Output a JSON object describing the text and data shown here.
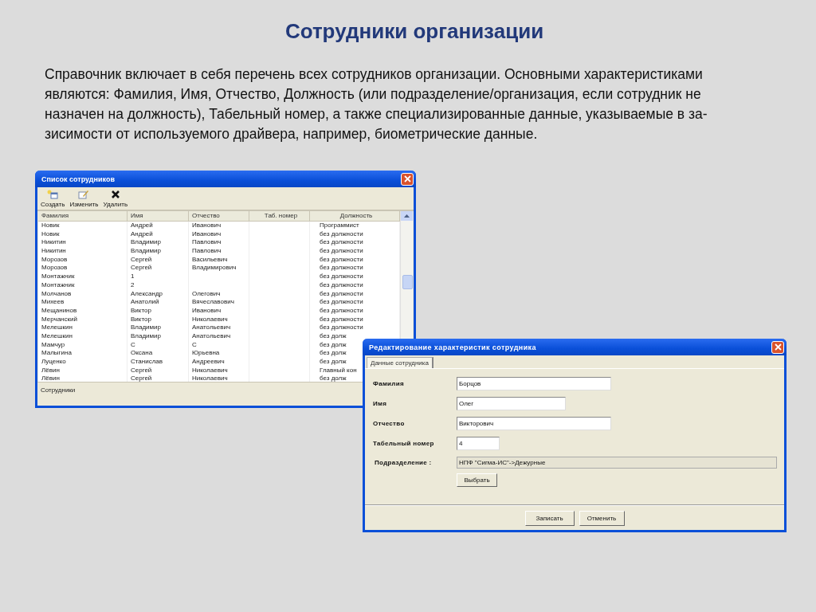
{
  "slide": {
    "title": "Сотрудники организации",
    "paragraph_lines": [
      "Справочник включает в себя перечень всех сотрудников организации. Основными характеристиками",
      "являются: Фамилия, Имя, Отчество, Должность (или подразделение/организация, если сотрудник не",
      "назначен на должность), Табельный номер, а также специализированные данные, указываемые в за-",
      "зисимости от используемого драйвера, например, биометрические данные."
    ]
  },
  "list_window": {
    "title": "Список сотрудников",
    "toolbar": [
      {
        "kind": "create",
        "label": "Создать"
      },
      {
        "kind": "edit",
        "label": "Изменить"
      },
      {
        "kind": "delete",
        "label": "Удалить"
      }
    ],
    "columns": [
      "Фамилия",
      "Имя",
      "Отчество",
      "Таб. номер",
      "Должность"
    ],
    "rows": [
      [
        "Новик",
        "Андрей",
        "Иванович",
        "",
        "Программист"
      ],
      [
        "Новик",
        "Андрей",
        "Иванович",
        "",
        "без должности"
      ],
      [
        "Никитин",
        "Владимир",
        "Павлович",
        "",
        "без должности"
      ],
      [
        "Никитин",
        "Владимир",
        "Павлович",
        "",
        "без должности"
      ],
      [
        "Морозов",
        "Сергей",
        "Васильевич",
        "",
        "без должности"
      ],
      [
        "Морозов",
        "Сергей",
        "Владимирович",
        "",
        "без должности"
      ],
      [
        "Монтажник",
        "1",
        "",
        "",
        "без должности"
      ],
      [
        "Монтажник",
        "2",
        "",
        "",
        "без должности"
      ],
      [
        "Молчанов",
        "Александр",
        "Олегович",
        "",
        "без должности"
      ],
      [
        "Михеев",
        "Анатолий",
        "Вячеславович",
        "",
        "без должности"
      ],
      [
        "Мещанинов",
        "Виктор",
        "Иванович",
        "",
        "без должности"
      ],
      [
        "Мерчанский",
        "Виктор",
        "Николаевич",
        "",
        "без должности"
      ],
      [
        "Мелешкин",
        "Владимир",
        "Анатольевич",
        "",
        "без должности"
      ],
      [
        "Мелешкин",
        "Владимир",
        "Анатольевич",
        "",
        "без долж"
      ],
      [
        "Мамчур",
        "С",
        "С",
        "",
        "без долж"
      ],
      [
        "Малыгина",
        "Оксана",
        "Юрьевна",
        "",
        "без долж"
      ],
      [
        "Луценко",
        "Станислав",
        "Андреевич",
        "",
        "без долж"
      ],
      [
        "Лёвин",
        "Сергей",
        "Николаевич",
        "",
        "Главный кон"
      ],
      [
        "Лёвин",
        "Сергей",
        "Николаевич",
        "",
        "без долж"
      ]
    ],
    "status_bar": "Сотрудники"
  },
  "edit_dialog": {
    "title": "Редактирование характеристик сотрудника",
    "tabs": [
      {
        "label": "Данные сотрудника",
        "selected": true
      }
    ],
    "fields": [
      {
        "label": "Фамилия",
        "value": "Борцов",
        "disabled": false
      },
      {
        "label": "Имя",
        "value": "Олег",
        "disabled": false
      },
      {
        "label": "Отчество",
        "value": "Викторович",
        "disabled": false
      },
      {
        "label": "Табельный номер",
        "value": "4",
        "disabled": false
      },
      {
        "label": "Подразделение :",
        "value": "НПФ \"Сигма-ИС\"->Дежурные",
        "disabled": true
      }
    ],
    "choose_button": "Выбрать",
    "buttons": [
      "Записать",
      "Отменить"
    ]
  }
}
